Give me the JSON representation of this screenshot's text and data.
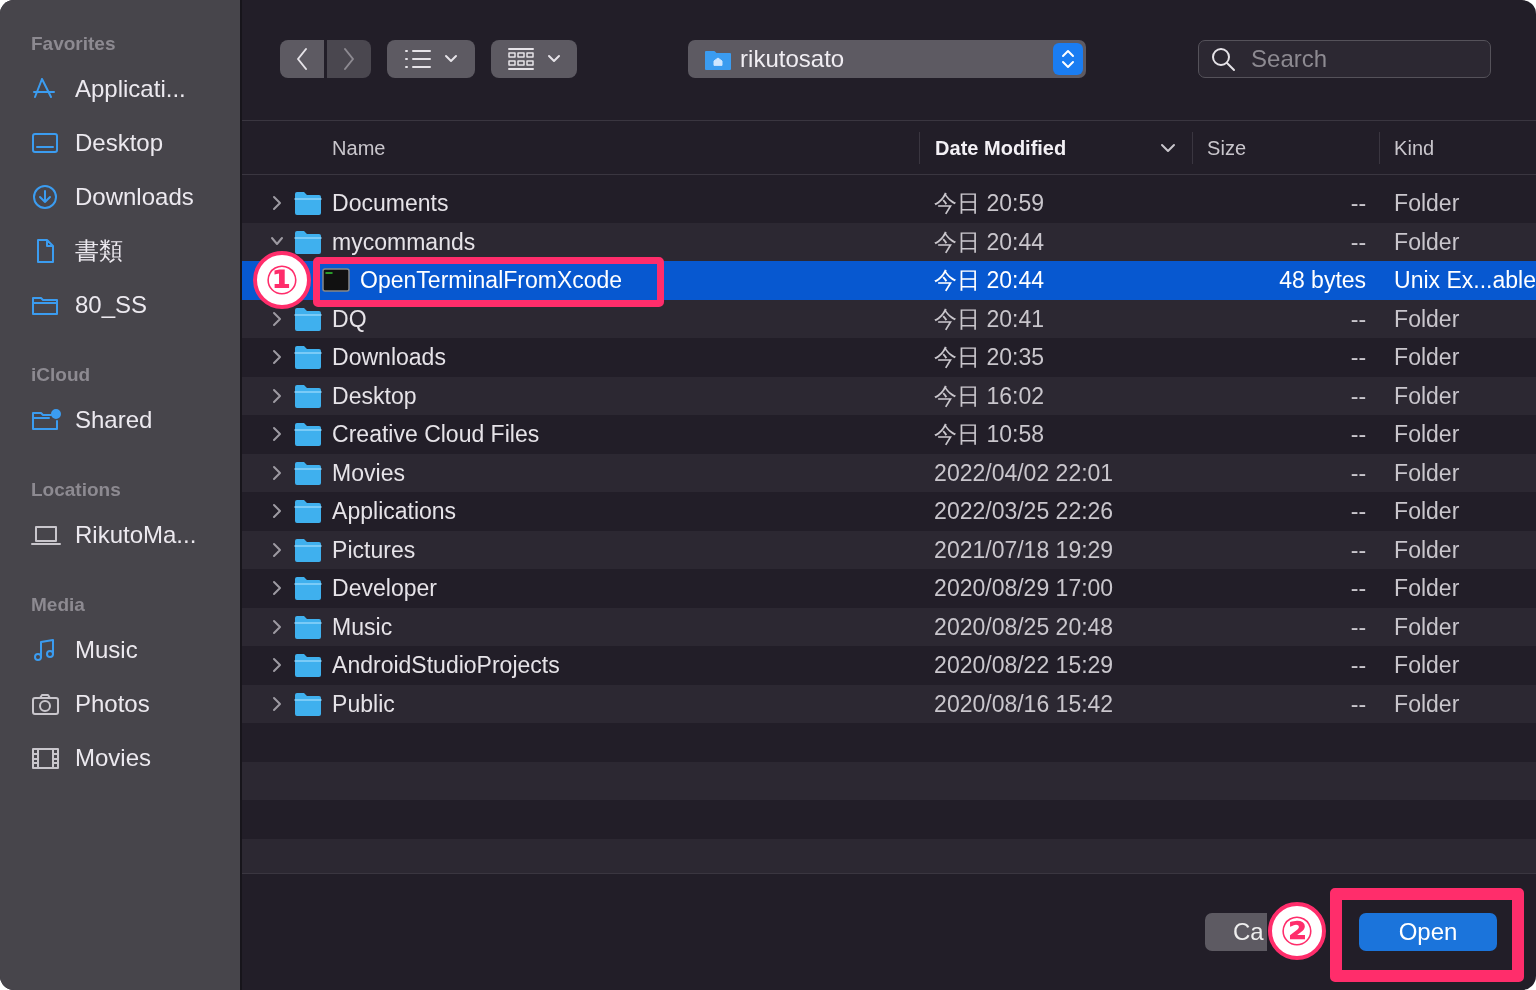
{
  "sidebar": {
    "sections": [
      {
        "title": "Favorites",
        "items": [
          {
            "label": "Applicati..."
          },
          {
            "label": "Desktop"
          },
          {
            "label": "Downloads"
          },
          {
            "label": "書類"
          },
          {
            "label": "80_SS"
          }
        ]
      },
      {
        "title": "iCloud",
        "items": [
          {
            "label": "Shared"
          }
        ]
      },
      {
        "title": "Locations",
        "items": [
          {
            "label": "RikutoMa..."
          }
        ]
      },
      {
        "title": "Media",
        "items": [
          {
            "label": "Music"
          },
          {
            "label": "Photos"
          },
          {
            "label": "Movies"
          }
        ]
      }
    ]
  },
  "toolbar": {
    "path": "rikutosato",
    "search": {
      "placeholder": "Search"
    }
  },
  "table": {
    "columns": [
      {
        "label": "Name",
        "sorted": false
      },
      {
        "label": "Date Modified",
        "sorted": true
      },
      {
        "label": "Size",
        "sorted": false
      },
      {
        "label": "Kind",
        "sorted": false
      }
    ],
    "rows": [
      {
        "kind": "folder",
        "name": "Documents",
        "date": "今日 20:59",
        "size": "--",
        "type": "Folder",
        "expanded": false,
        "selected": false
      },
      {
        "kind": "folder",
        "name": "mycommands",
        "date": "今日 20:44",
        "size": "--",
        "type": "Folder",
        "expanded": true,
        "selected": false,
        "children": [
          {
            "kind": "executable",
            "name": "OpenTerminalFromXcode",
            "date": "今日 20:44",
            "size": "48 bytes",
            "type": "Unix Ex...able",
            "selected": true
          }
        ]
      },
      {
        "kind": "folder",
        "name": "DQ",
        "date": "今日 20:41",
        "size": "--",
        "type": "Folder",
        "expanded": false,
        "selected": false
      },
      {
        "kind": "folder",
        "name": "Downloads",
        "date": "今日 20:35",
        "size": "--",
        "type": "Folder",
        "expanded": false,
        "selected": false
      },
      {
        "kind": "folder",
        "name": "Desktop",
        "date": "今日 16:02",
        "size": "--",
        "type": "Folder",
        "expanded": false,
        "selected": false
      },
      {
        "kind": "folder",
        "name": "Creative Cloud Files",
        "date": "今日 10:58",
        "size": "--",
        "type": "Folder",
        "expanded": false,
        "selected": false
      },
      {
        "kind": "folder",
        "name": "Movies",
        "date": "2022/04/02 22:01",
        "size": "--",
        "type": "Folder",
        "expanded": false,
        "selected": false
      },
      {
        "kind": "folder",
        "name": "Applications",
        "date": "2022/03/25 22:26",
        "size": "--",
        "type": "Folder",
        "expanded": false,
        "selected": false
      },
      {
        "kind": "folder",
        "name": "Pictures",
        "date": "2021/07/18 19:29",
        "size": "--",
        "type": "Folder",
        "expanded": false,
        "selected": false
      },
      {
        "kind": "folder",
        "name": "Developer",
        "date": "2020/08/29 17:00",
        "size": "--",
        "type": "Folder",
        "expanded": false,
        "selected": false
      },
      {
        "kind": "folder",
        "name": "Music",
        "date": "2020/08/25 20:48",
        "size": "--",
        "type": "Folder",
        "expanded": false,
        "selected": false
      },
      {
        "kind": "folder",
        "name": "AndroidStudioProjects",
        "date": "2020/08/22 15:29",
        "size": "--",
        "type": "Folder",
        "expanded": false,
        "selected": false
      },
      {
        "kind": "folder",
        "name": "Public",
        "date": "2020/08/16 15:42",
        "size": "--",
        "type": "Folder",
        "expanded": false,
        "selected": false
      }
    ]
  },
  "buttons": [
    {
      "label": "Ca",
      "primary": false
    },
    {
      "label": "Open",
      "primary": true
    }
  ],
  "annotations": [
    {
      "label": "①"
    },
    {
      "label": "②"
    }
  ]
}
